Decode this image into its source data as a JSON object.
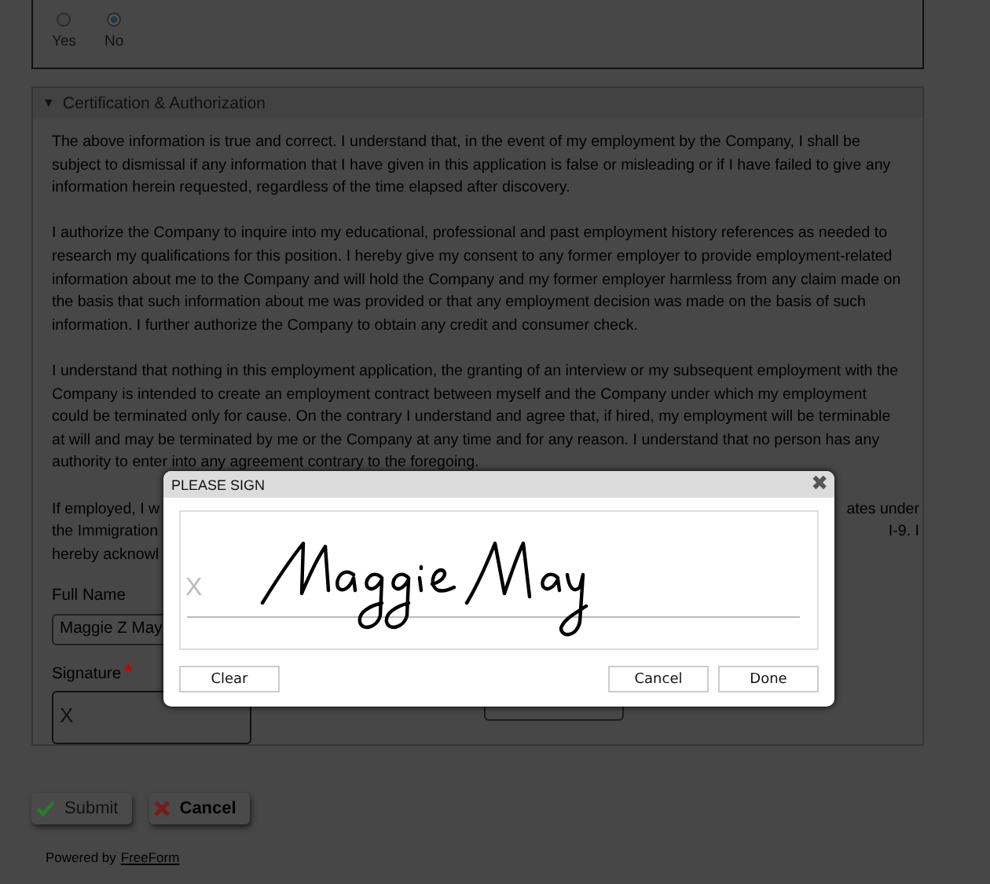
{
  "choice": {
    "options": [
      {
        "label": "Yes",
        "selected": false
      },
      {
        "label": "No",
        "selected": true
      }
    ]
  },
  "section": {
    "title": "Certification & Authorization",
    "expanded": true,
    "toggle": "▼",
    "paragraphs": [
      "The above information is true and correct. I understand that, in the event of my employment by the Company, I shall be subject to dismissal if any information that I have given in this application is false or misleading or if I have failed to give any information herein requested, regardless of the time elapsed after discovery.",
      "I authorize the Company to inquire into my educational, professional and past employment history references as needed to research my qualifications for this position. I hereby give my consent to any former employer to provide employment-related information about me to the Company and will hold the Company and my former employer harmless from any claim made on the basis that such information about me was provided or that any employment decision was made on the basis of such information. I further authorize the Company to obtain any credit and consumer check.",
      "I understand that nothing in this employment application, the granting of an interview or my subsequent employment with the Company is intended to create an employment contract between myself and the Company under which my employment could be terminated only for cause. On the contrary I understand and agree that, if hired, my employment will be terminable at will and may be terminated by me or the Company at any time and for any reason. I understand that no person has any authority to enter into any agreement contrary to the foregoing."
    ],
    "covered_paragraph": [
      {
        "left": "If employed, I w",
        "right": "ates under"
      },
      {
        "left": "the Immigration",
        "right": "I-9. I"
      },
      {
        "left": "hereby acknowl"
      }
    ],
    "full_name": {
      "label": "Full Name",
      "value": "Maggie Z May"
    },
    "signature": {
      "label": "Signature",
      "required_mark": "*",
      "placeholder": "X"
    }
  },
  "actions": [
    {
      "kind": "submit",
      "label": "Submit",
      "disabled": true
    },
    {
      "kind": "cancel",
      "label": "Cancel",
      "disabled": false
    }
  ],
  "footer": {
    "prefix": "Powered by",
    "link": "FreeForm"
  },
  "dialog": {
    "title": "PLEASE SIGN",
    "close": "✖",
    "pad_mark": "X",
    "buttons": [
      {
        "label": "Clear",
        "kind": "left"
      },
      {
        "label": "Cancel",
        "kind": "right"
      },
      {
        "label": "Done",
        "kind": "right"
      }
    ]
  }
}
